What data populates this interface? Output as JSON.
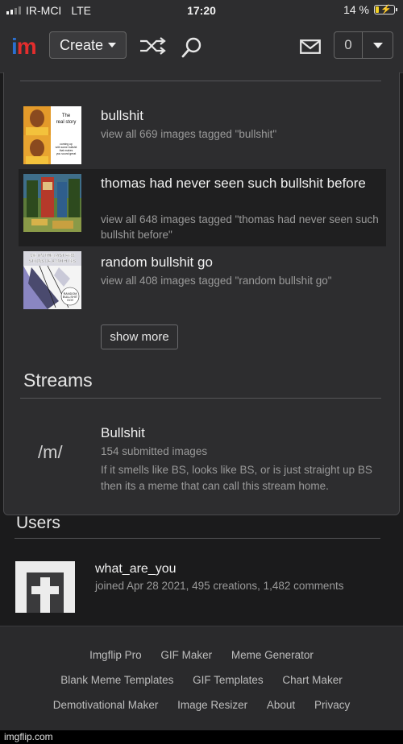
{
  "status_bar": {
    "carrier": "IR-MCI",
    "network": "LTE",
    "time": "17:20",
    "battery": "14 %"
  },
  "nav": {
    "logo": {
      "i": "i",
      "m": "m"
    },
    "create_label": "Create",
    "notifications_count": "0",
    "icons": [
      "shuffle-icon",
      "search-icon",
      "mail-icon",
      "chevron-down-icon"
    ]
  },
  "tags": [
    {
      "title": "bullshit",
      "subtitle": "view all 669 images tagged \"bullshit\""
    },
    {
      "title": "thomas had never seen such bullshit before",
      "subtitle": "view all 648 images tagged \"thomas had never seen such bullshit before\""
    },
    {
      "title": "random bullshit go",
      "subtitle": "view all 408 images tagged \"random bullshit go\""
    }
  ],
  "thumb_text": {
    "t1_top": "The real story",
    "t1_bottom": "coming up with some bullshit that makes you sound great",
    "t3_top": "ME ON THE LAST FEW QUESTIONS OF A MATH TEST",
    "t3_bottom": "RANDOM BULLSHIT GO!!"
  },
  "show_more_label": "show more",
  "streams": {
    "heading": "Streams",
    "mark": "/m/",
    "title": "Bullshit",
    "count": "154 submitted images",
    "description": "If it smells like BS, looks like BS, or is just straight up BS then its a meme that can call this stream home."
  },
  "users": {
    "heading": "Users",
    "name": "what_are_you",
    "info": "joined Apr 28 2021, 495 creations, 1,482 comments"
  },
  "footer": {
    "row1": [
      "Imgflip Pro",
      "GIF Maker",
      "Meme Generator"
    ],
    "row2": [
      "Blank Meme Templates",
      "GIF Templates",
      "Chart Maker"
    ],
    "row3": [
      "Demotivational Maker",
      "Image Resizer",
      "About",
      "Privacy"
    ]
  },
  "watermark": "imgflip.com",
  "colors": {
    "logo_i": "#2b6fcf",
    "logo_m": "#e32d2d",
    "background": "#1b1b1c",
    "panel": "#2d2d2f"
  }
}
